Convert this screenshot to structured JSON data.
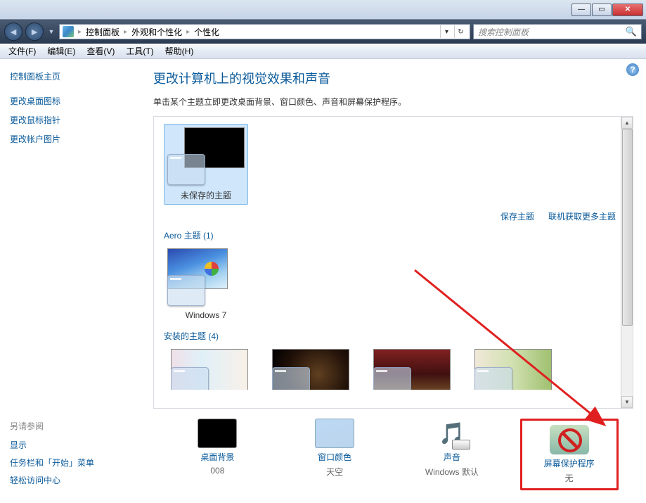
{
  "titlebar": {
    "min": "—",
    "max": "▭",
    "close": "✕"
  },
  "nav": {
    "back": "◄",
    "fwd": "►",
    "drop": "▼",
    "address": {
      "root": "控制面板",
      "seg1": "外观和个性化",
      "seg2": "个性化"
    },
    "addr_drop": "▾",
    "addr_refresh": "↻",
    "search_placeholder": "搜索控制面板",
    "search_icon": "🔍"
  },
  "menu": {
    "file": "文件(F)",
    "edit": "编辑(E)",
    "view": "查看(V)",
    "tools": "工具(T)",
    "help": "帮助(H)"
  },
  "sidebar": {
    "home": "控制面板主页",
    "link1": "更改桌面图标",
    "link2": "更改鼠标指针",
    "link3": "更改帐户图片",
    "see_also": "另请参阅",
    "item1": "显示",
    "item2": "任务栏和「开始」菜单",
    "item3": "轻松访问中心"
  },
  "content": {
    "help": "?",
    "title": "更改计算机上的视觉效果和声音",
    "sub": "单击某个主题立即更改桌面背景、窗口颜色、声音和屏幕保护程序。",
    "unsaved_theme": "未保存的主题",
    "link_save": "保存主题",
    "link_more": "联机获取更多主题",
    "aero_head": "Aero 主题 (1)",
    "aero1": "Windows 7",
    "installed_head": "安装的主题 (4)",
    "scroll_up": "▲",
    "scroll_down": "▼"
  },
  "settings": {
    "desk": {
      "label": "桌面背景",
      "val": "008"
    },
    "color": {
      "label": "窗口颜色",
      "val": "天空"
    },
    "sound": {
      "label": "声音",
      "val": "Windows 默认",
      "icon": "🎵"
    },
    "screensaver": {
      "label": "屏幕保护程序",
      "val": "无"
    }
  }
}
